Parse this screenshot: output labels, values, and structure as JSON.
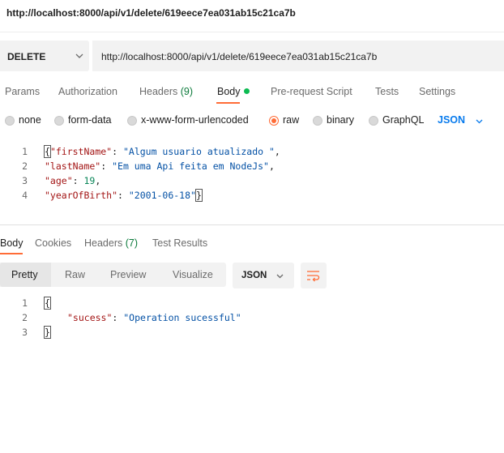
{
  "window": {
    "title": "http://localhost:8000/api/v1/delete/619eece7ea031ab15c21ca7b"
  },
  "request": {
    "method": "DELETE",
    "url": "http://localhost:8000/api/v1/delete/619eece7ea031ab15c21ca7b"
  },
  "request_tabs": {
    "params": "Params",
    "authorization": "Authorization",
    "headers": "Headers",
    "headers_count": "(9)",
    "body": "Body",
    "pre_request_script": "Pre-request Script",
    "tests": "Tests",
    "settings": "Settings"
  },
  "body_types": {
    "none": "none",
    "form_data": "form-data",
    "urlencoded": "x-www-form-urlencoded",
    "raw": "raw",
    "binary": "binary",
    "graphql": "GraphQL",
    "language": "JSON",
    "selected": "raw"
  },
  "request_body": {
    "line_numbers": [
      "1",
      "2",
      "3",
      "4"
    ],
    "open_brace": "{",
    "close_brace": "}",
    "k1": "\"firstName\"",
    "v1": "\"Algum usuario atualizado \"",
    "k2": "\"lastName\"",
    "v2": "\"Em uma Api feita em NodeJs\"",
    "k3": "\"age\"",
    "v3": "19",
    "k4": "\"yearOfBirth\"",
    "v4": "\"2001-06-18\""
  },
  "response_tabs": {
    "body": "Body",
    "cookies": "Cookies",
    "headers": "Headers",
    "headers_count": "(7)",
    "test_results": "Test Results"
  },
  "response_view": {
    "pretty": "Pretty",
    "raw": "Raw",
    "preview": "Preview",
    "visualize": "Visualize",
    "format": "JSON"
  },
  "response_body": {
    "line_numbers": [
      "1",
      "2",
      "3"
    ],
    "open_brace": "{",
    "close_brace": "}",
    "k1": "\"sucess\"",
    "v1": "\"Operation sucessful\""
  },
  "colors": {
    "accent": "#ff6c37",
    "link_blue": "#097bed",
    "count_green": "#0c7a3b",
    "body_dot": "#0cbb52"
  }
}
